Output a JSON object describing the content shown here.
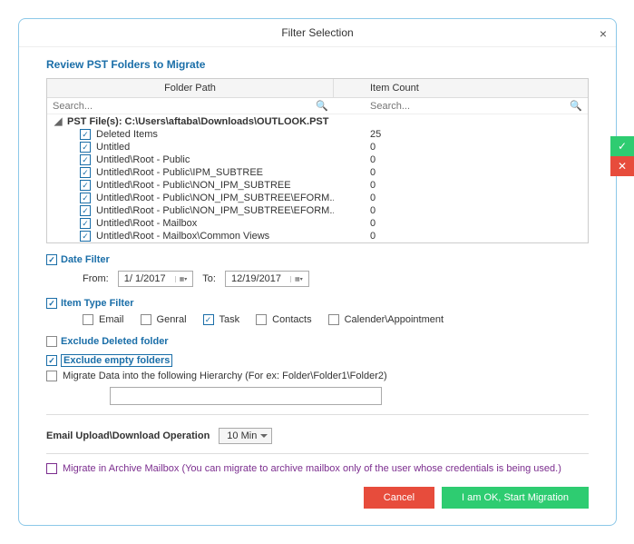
{
  "title": "Filter Selection",
  "section_review": "Review PST Folders to Migrate",
  "columns": {
    "folder": "Folder Path",
    "count": "Item Count"
  },
  "search": {
    "placeholder_folder": "Search...",
    "placeholder_count": "Search..."
  },
  "root": {
    "label": "PST File(s): C:\\Users\\aftaba\\Downloads\\OUTLOOK.PST"
  },
  "folders": [
    {
      "name": "Deleted Items",
      "count": "25"
    },
    {
      "name": "Untitled",
      "count": "0"
    },
    {
      "name": "Untitled\\Root - Public",
      "count": "0"
    },
    {
      "name": "Untitled\\Root - Public\\IPM_SUBTREE",
      "count": "0"
    },
    {
      "name": "Untitled\\Root - Public\\NON_IPM_SUBTREE",
      "count": "0"
    },
    {
      "name": "Untitled\\Root - Public\\NON_IPM_SUBTREE\\EFORM...",
      "count": "0"
    },
    {
      "name": "Untitled\\Root - Public\\NON_IPM_SUBTREE\\EFORM...",
      "count": "0"
    },
    {
      "name": "Untitled\\Root - Mailbox",
      "count": "0"
    },
    {
      "name": "Untitled\\Root - Mailbox\\Common Views",
      "count": "0"
    }
  ],
  "date_filter": {
    "label": "Date Filter",
    "from_label": "From:",
    "from_value": "1/  1/2017",
    "to_label": "To:",
    "to_value": "12/19/2017"
  },
  "item_type": {
    "label": "Item Type Filter",
    "types": {
      "email": "Email",
      "general": "Genral",
      "task": "Task",
      "contacts": "Contacts",
      "calendar": "Calender\\Appointment"
    }
  },
  "exclude_deleted": "Exclude Deleted folder",
  "exclude_empty": "Exclude empty folders",
  "hierarchy": "Migrate Data into the following Hierarchy (For ex: Folder\\Folder1\\Folder2)",
  "upload": {
    "label": "Email Upload\\Download Operation",
    "value": "10 Min"
  },
  "archive": "Migrate in Archive Mailbox (You can migrate to archive mailbox only of the user whose credentials is being used.)",
  "buttons": {
    "cancel": "Cancel",
    "ok": "I am OK, Start Migration"
  }
}
